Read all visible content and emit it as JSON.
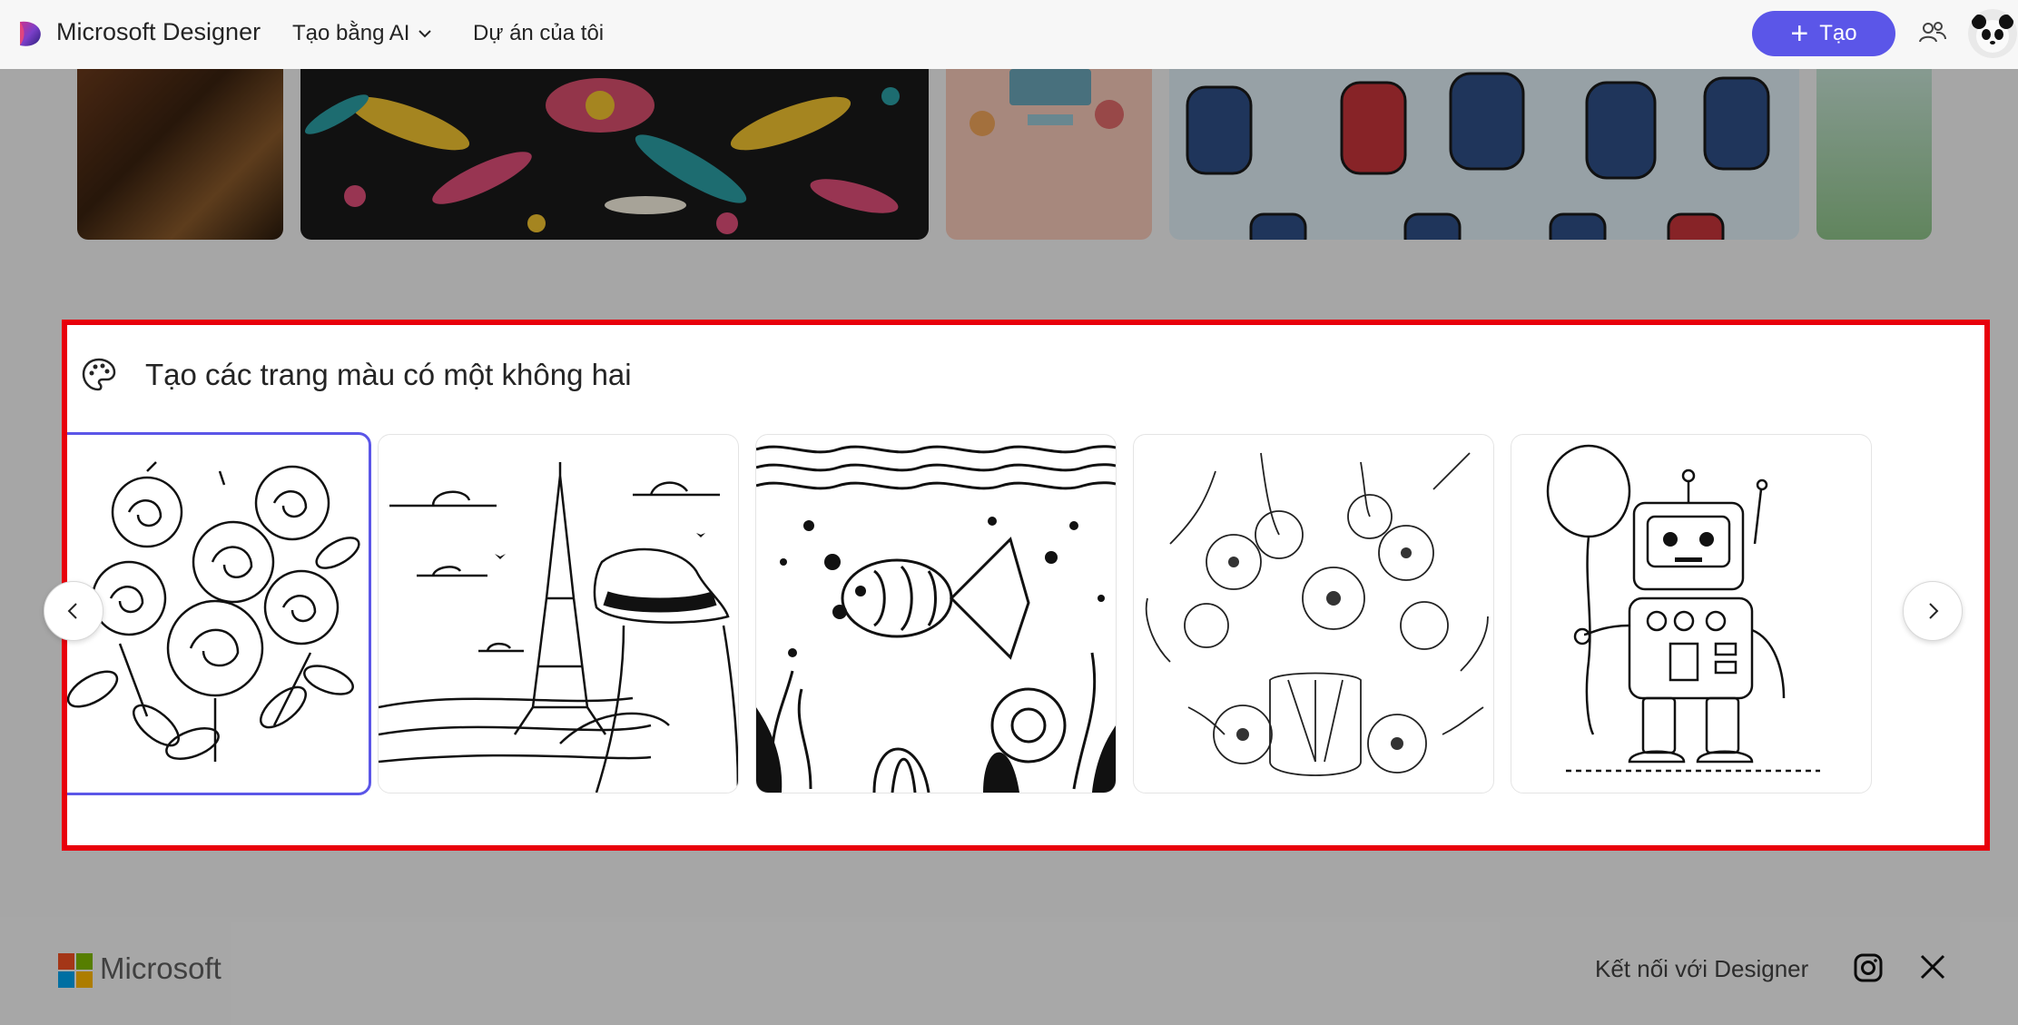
{
  "header": {
    "brand": "Microsoft Designer",
    "nav_ai": "Tạo bằng AI",
    "nav_projects": "Dự án của tôi",
    "create_label": "Tạo",
    "accent": "#5b56e8"
  },
  "section": {
    "title": "Tạo các trang màu có một không hai",
    "highlight_color": "#e8000b",
    "cards": [
      {
        "subject": "roses-coloring-page"
      },
      {
        "subject": "eiffel-tower-coloring-page"
      },
      {
        "subject": "fish-underwater-coloring-page"
      },
      {
        "subject": "flower-vase-coloring-page"
      },
      {
        "subject": "robot-balloon-coloring-page"
      }
    ]
  },
  "footer": {
    "brand": "Microsoft",
    "connect": "Kết nối với Designer"
  },
  "icons": {
    "logo": "designer-logo-icon",
    "dropdown": "chevron-down-icon",
    "people": "people-icon",
    "palette": "palette-icon",
    "instagram": "instagram-icon",
    "x": "x-icon"
  }
}
